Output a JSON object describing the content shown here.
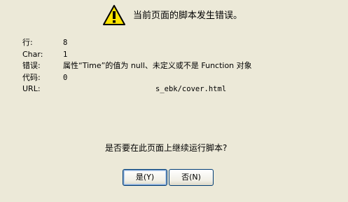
{
  "dialog": {
    "icon": "warning-icon",
    "message": "当前页面的脚本发生错误。",
    "details": [
      {
        "label": "行:",
        "value": "8"
      },
      {
        "label": "Char:",
        "value": "1"
      },
      {
        "label": "错误:",
        "value": "属性“Time”的值为 null、未定义或不是 Function 对象"
      },
      {
        "label": "代码:",
        "value": "0"
      },
      {
        "label": "URL:",
        "value": "s_ebk/cover.html"
      }
    ],
    "question": "是否要在此页面上继续运行脚本?",
    "yes_button": "是(Y)",
    "no_button": "否(N)"
  },
  "colors": {
    "background": "#ECE9D8",
    "warning_fill": "#FFE500",
    "button_border": "#003C74"
  }
}
